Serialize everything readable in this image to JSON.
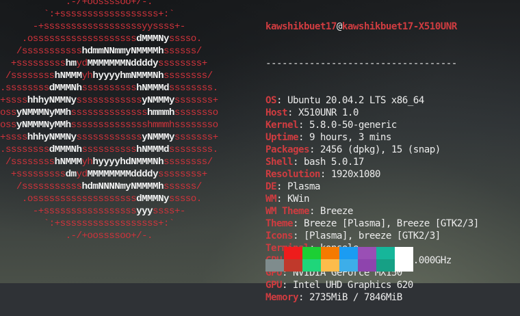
{
  "logo": {
    "lines": [
      [
        {
          "t": "            .-/+oossssoo+/-.",
          "c": "r"
        }
      ],
      [
        {
          "t": "        `:+ssssssssssssssssss+:`",
          "c": "r"
        }
      ],
      [
        {
          "t": "      -+ssssssssssssssssssyyssss+-",
          "c": "r"
        }
      ],
      [
        {
          "t": "    .osssssssssssssssssss",
          "c": "r"
        },
        {
          "t": "dMMMNy",
          "c": "w"
        },
        {
          "t": "sssso.",
          "c": "r"
        }
      ],
      [
        {
          "t": "   /sssssssssss",
          "c": "r"
        },
        {
          "t": "hdmmNNmmyNMMMMh",
          "c": "w"
        },
        {
          "t": "ssssss/",
          "c": "r"
        }
      ],
      [
        {
          "t": "  +sssssssss",
          "c": "r"
        },
        {
          "t": "hm",
          "c": "w"
        },
        {
          "t": "yd",
          "c": "r"
        },
        {
          "t": "MMMMMMMNddddy",
          "c": "w"
        },
        {
          "t": "ssssssss+",
          "c": "r"
        }
      ],
      [
        {
          "t": " /ssssssss",
          "c": "r"
        },
        {
          "t": "hNMMM",
          "c": "w"
        },
        {
          "t": "yh",
          "c": "r"
        },
        {
          "t": "hyyyyhmNMMMNh",
          "c": "w"
        },
        {
          "t": "ssssssss/",
          "c": "r"
        }
      ],
      [
        {
          "t": ".ssssssss",
          "c": "r"
        },
        {
          "t": "dMMMNh",
          "c": "w"
        },
        {
          "t": "ssssssssss",
          "c": "r"
        },
        {
          "t": "hNMMMd",
          "c": "w"
        },
        {
          "t": "ssssssss.",
          "c": "r"
        }
      ],
      [
        {
          "t": "+ssss",
          "c": "r"
        },
        {
          "t": "hhhyNMMNy",
          "c": "w"
        },
        {
          "t": "ssssssssssss",
          "c": "r"
        },
        {
          "t": "yNMMMy",
          "c": "w"
        },
        {
          "t": "sssssss+",
          "c": "r"
        }
      ],
      [
        {
          "t": "oss",
          "c": "r"
        },
        {
          "t": "yNMMMNyMMh",
          "c": "w"
        },
        {
          "t": "ssssssssssssss",
          "c": "r"
        },
        {
          "t": "hmmmh",
          "c": "w"
        },
        {
          "t": "ssssssso",
          "c": "r"
        }
      ],
      [
        {
          "t": "oss",
          "c": "r"
        },
        {
          "t": "yNMMMNyMMh",
          "c": "w"
        },
        {
          "t": "sssssssssssssshmmmhssssssso",
          "c": "r"
        }
      ],
      [
        {
          "t": "+ssss",
          "c": "r"
        },
        {
          "t": "hhhyNMMNy",
          "c": "w"
        },
        {
          "t": "ssssssssssss",
          "c": "r"
        },
        {
          "t": "yNMMMy",
          "c": "w"
        },
        {
          "t": "sssssss+",
          "c": "r"
        }
      ],
      [
        {
          "t": ".ssssssss",
          "c": "r"
        },
        {
          "t": "dMMMNh",
          "c": "w"
        },
        {
          "t": "ssssssssss",
          "c": "r"
        },
        {
          "t": "hNMMMd",
          "c": "w"
        },
        {
          "t": "ssssssss.",
          "c": "r"
        }
      ],
      [
        {
          "t": " /ssssssss",
          "c": "r"
        },
        {
          "t": "hNMMM",
          "c": "w"
        },
        {
          "t": "yh",
          "c": "r"
        },
        {
          "t": "hyyyyhdNMMMNh",
          "c": "w"
        },
        {
          "t": "ssssssss/",
          "c": "r"
        }
      ],
      [
        {
          "t": "  +sssssssss",
          "c": "r"
        },
        {
          "t": "dm",
          "c": "w"
        },
        {
          "t": "yd",
          "c": "r"
        },
        {
          "t": "MMMMMMMMddddy",
          "c": "w"
        },
        {
          "t": "ssssssss+",
          "c": "r"
        }
      ],
      [
        {
          "t": "   /sssssssssss",
          "c": "r"
        },
        {
          "t": "hdmNNNNmyNMMMMh",
          "c": "w"
        },
        {
          "t": "ssssss/",
          "c": "r"
        }
      ],
      [
        {
          "t": "    .osssssssssssssssssss",
          "c": "r"
        },
        {
          "t": "dMMMNy",
          "c": "w"
        },
        {
          "t": "sssso.",
          "c": "r"
        }
      ],
      [
        {
          "t": "      -+sssssssssssssssss",
          "c": "r"
        },
        {
          "t": "yyy",
          "c": "w"
        },
        {
          "t": "ssss+-",
          "c": "r"
        }
      ],
      [
        {
          "t": "        `:+ssssssssssssssssss+:`",
          "c": "r"
        }
      ],
      [
        {
          "t": "            .-/+oossssoo+/-.",
          "c": "r"
        }
      ]
    ]
  },
  "user": "kawshikbuet17",
  "at_sign": "@",
  "host": "kawshikbuet17-X510UNR",
  "separator": "-----------------------------------",
  "info": [
    {
      "key": "OS",
      "value": "Ubuntu 20.04.2 LTS x86_64"
    },
    {
      "key": "Host",
      "value": "X510UNR 1.0"
    },
    {
      "key": "Kernel",
      "value": "5.8.0-50-generic"
    },
    {
      "key": "Uptime",
      "value": "9 hours, 3 mins"
    },
    {
      "key": "Packages",
      "value": "2456 (dpkg), 15 (snap)"
    },
    {
      "key": "Shell",
      "value": "bash 5.0.17"
    },
    {
      "key": "Resolution",
      "value": "1920x1080"
    },
    {
      "key": "DE",
      "value": "Plasma"
    },
    {
      "key": "WM",
      "value": "KWin"
    },
    {
      "key": "WM Theme",
      "value": "Breeze"
    },
    {
      "key": "Theme",
      "value": "Breeze [Plasma], Breeze [GTK2/3]"
    },
    {
      "key": "Icons",
      "value": "[Plasma], breeze [GTK2/3]"
    },
    {
      "key": "Terminal",
      "value": "konsole"
    },
    {
      "key": "CPU",
      "value": "Intel i7-8550U (8) @ 4.000GHz"
    },
    {
      "key": "GPU",
      "value": "NVIDIA GeForce MX150"
    },
    {
      "key": "GPU",
      "value": "Intel UHD Graphics 620"
    },
    {
      "key": "Memory",
      "value": "2735MiB / 7846MiB"
    }
  ],
  "colors": {
    "accent": "#cf3c40",
    "logo_red": "#d0333b",
    "logo_white": "#f2f2f2",
    "palette_top": [
      "transparent",
      "#ee1c1c",
      "#1ccf34",
      "#f57a00",
      "#1b9cf2",
      "#9a4fb5",
      "#16b69a",
      "#ffffff"
    ],
    "palette_bottom": [
      "#7f8c8d",
      "#c0392b",
      "#1fd67a",
      "#fdbc4b",
      "#3daee9",
      "#8e44ad",
      "#16a085",
      "#ffffff"
    ]
  }
}
